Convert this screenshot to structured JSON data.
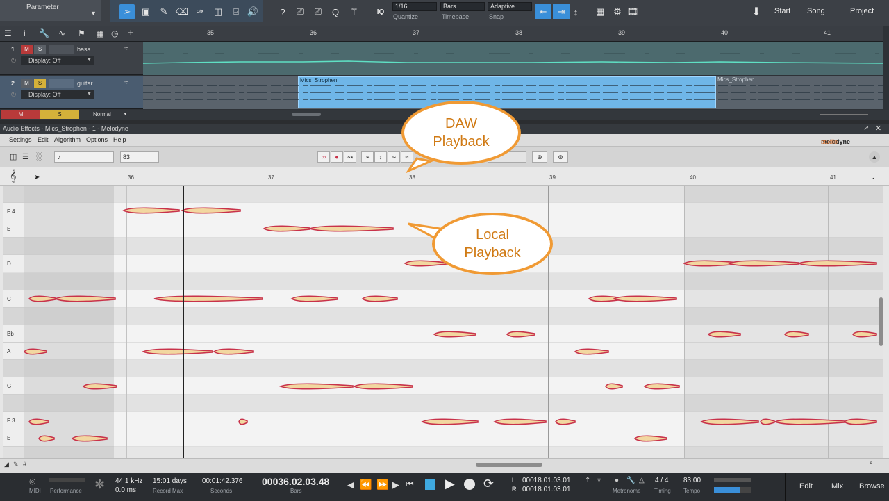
{
  "toolbar": {
    "parameter_label": "Parameter",
    "quantize_value": "1/16",
    "quantize_label": "Quantize",
    "timebase_value": "Bars",
    "timebase_label": "Timebase",
    "snap_value": "Adaptive",
    "snap_label": "Snap",
    "iq_label": "IQ",
    "nav": [
      "Start",
      "Song",
      "Project"
    ]
  },
  "arrange": {
    "bars": [
      "35",
      "36",
      "37",
      "38",
      "39",
      "40",
      "41"
    ],
    "tracks": [
      {
        "num": "1",
        "name": "bass",
        "mute": "M",
        "solo": "S",
        "display": "Display: Off"
      },
      {
        "num": "2",
        "name": "guitar",
        "mute": "M",
        "solo": "S",
        "display": "Display: Off"
      }
    ],
    "clip_name": "Mics_Strophen",
    "clip_name_2": "Mics_Strophen",
    "footer_mute": "M",
    "footer_solo": "S",
    "footer_mode": "Normal"
  },
  "melodyne": {
    "title": "Audio Effects - Mics_Strophen - 1 - Melodyne",
    "menu": [
      "Settings",
      "Edit",
      "Algorithm",
      "Options",
      "Help"
    ],
    "brand": "melodyne",
    "brand_suffix": "studio",
    "tempo_field": "83",
    "bars": [
      "36",
      "37",
      "38",
      "39",
      "40",
      "41"
    ],
    "keys": [
      "",
      "F 4",
      "E",
      "",
      "D",
      "",
      "C",
      "",
      "Bb",
      "A",
      "",
      "G",
      "",
      "F 3",
      "E"
    ]
  },
  "callouts": {
    "daw": "DAW Playback",
    "local": "Local Playback"
  },
  "transport": {
    "midi_label": "MIDI",
    "performance_label": "Performance",
    "sample_rate": "44.1 kHz",
    "latency": "0.0 ms",
    "record_max_value": "15:01 days",
    "record_max_label": "Record Max",
    "seconds_value": "00:01:42.376",
    "seconds_label": "Seconds",
    "bars_value": "00036.02.03.48",
    "bars_label": "Bars",
    "loop_l_label": "L",
    "loop_l": "00018.01.03.01",
    "loop_r_label": "R",
    "loop_r": "00018.01.03.01",
    "metronome_label": "Metronome",
    "timing_value": "4 / 4",
    "timing_label": "Timing",
    "tempo_value": "83.00",
    "tempo_label": "Tempo",
    "nav": [
      "Edit",
      "Mix",
      "Browse"
    ]
  },
  "colors": {
    "accent": "#3a8fd9",
    "clip": "#6fb6e8",
    "blob_outline": "#c8324a",
    "blob_fill": "#f2d7a0",
    "callout": "#f09a34"
  }
}
